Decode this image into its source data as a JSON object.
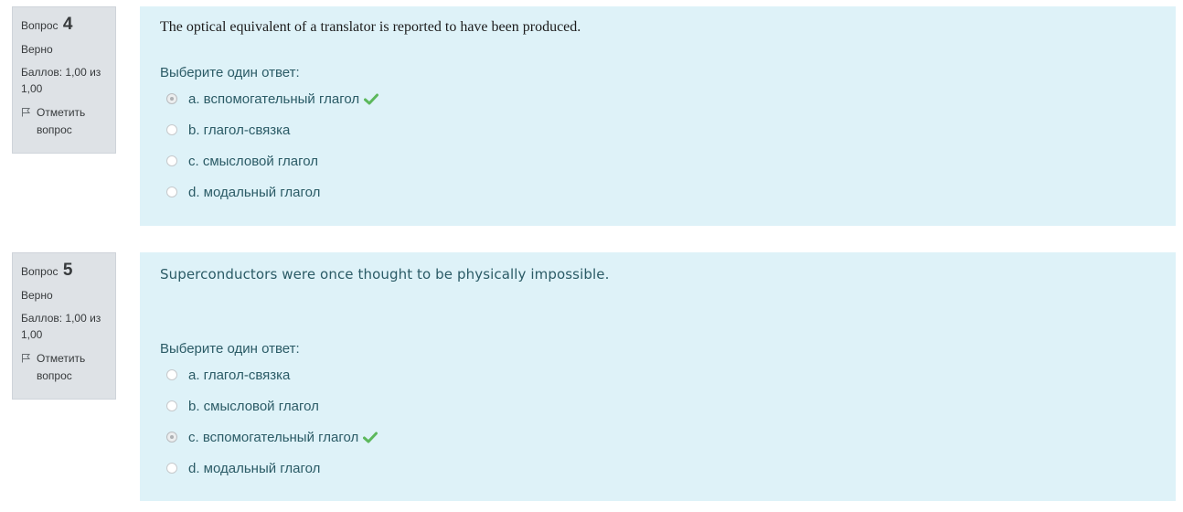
{
  "questions": [
    {
      "label": "Вопрос",
      "number": "4",
      "state": "Верно",
      "grade": "Баллов: 1,00 из 1,00",
      "flag_label": "Отметить вопрос",
      "text": "The optical equivalent of a translator is reported to have been produced.",
      "prompt": "Выберите один ответ:",
      "answers": [
        {
          "label": "a. вспомогательный глагол",
          "selected": true,
          "correct": true
        },
        {
          "label": "b. глагол-связка",
          "selected": false,
          "correct": false
        },
        {
          "label": "c. смысловой глагол",
          "selected": false,
          "correct": false
        },
        {
          "label": "d. модальный глагол",
          "selected": false,
          "correct": false
        }
      ]
    },
    {
      "label": "Вопрос",
      "number": "5",
      "state": "Верно",
      "grade": "Баллов: 1,00 из 1,00",
      "flag_label": "Отметить вопрос",
      "text": "Superconductors were once thought to be physically impossible.",
      "prompt": "Выберите один ответ:",
      "answers": [
        {
          "label": "a. глагол-связка",
          "selected": false,
          "correct": false
        },
        {
          "label": "b. смысловой глагол",
          "selected": false,
          "correct": false
        },
        {
          "label": "c. вспомогательный глагол",
          "selected": true,
          "correct": true
        },
        {
          "label": "d. модальный глагол",
          "selected": false,
          "correct": false
        }
      ]
    }
  ],
  "colors": {
    "info_bg": "#dee2e6",
    "content_bg": "#def2f8",
    "correct_check": "#5cb85c"
  },
  "icons": [
    "flag-icon",
    "check-icon",
    "radio-icon"
  ]
}
